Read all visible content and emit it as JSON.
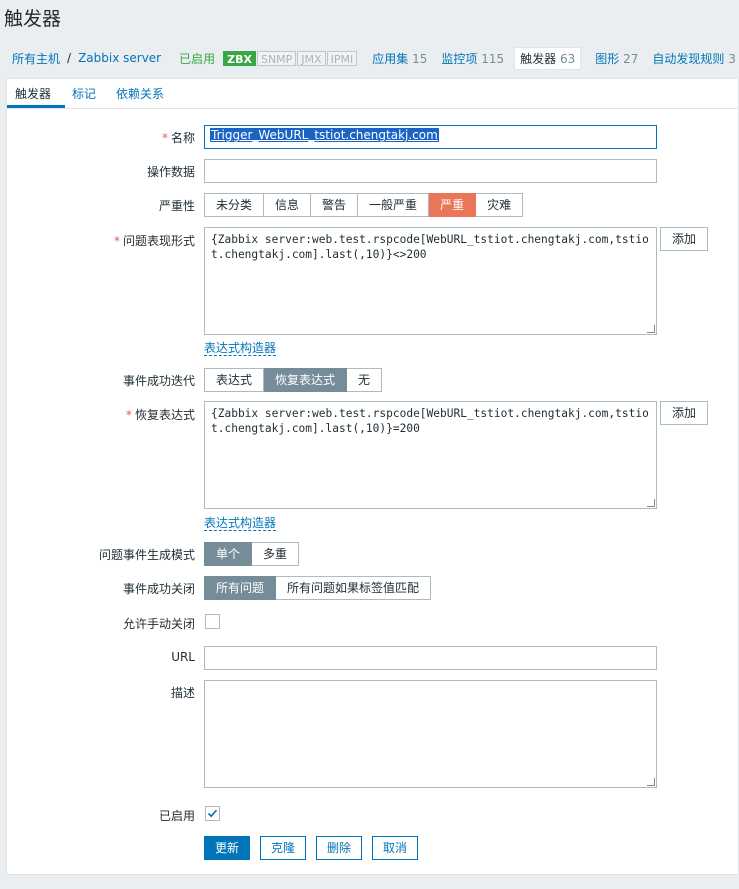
{
  "page": {
    "title": "触发器"
  },
  "nav": {
    "all_hosts": "所有主机",
    "separator": "/",
    "host": "Zabbix server",
    "status": "已启用",
    "availability": [
      "ZBX",
      "SNMP",
      "JMX",
      "IPMI"
    ],
    "links": [
      {
        "label": "应用集",
        "count": "15"
      },
      {
        "label": "监控项",
        "count": "115"
      },
      {
        "label": "触发器",
        "count": "63"
      },
      {
        "label": "图形",
        "count": "27"
      },
      {
        "label": "自动发现规则",
        "count": "3"
      }
    ]
  },
  "tabs": [
    "触发器",
    "标记",
    "依赖关系"
  ],
  "form": {
    "name_label": "名称",
    "name_value": "Trigger_WebURL_tstiot.chengtakj.com",
    "opdata_label": "操作数据",
    "opdata_value": "",
    "severity_label": "严重性",
    "severity_options": [
      "未分类",
      "信息",
      "警告",
      "一般严重",
      "严重",
      "灾难"
    ],
    "severity_selected": "严重",
    "problem_expr_label": "问题表现形式",
    "problem_expr_value": "{Zabbix server:web.test.rspcode[WebURL_tstiot.chengtakj.com,tstiot.chengtakj.com].last(,10)}<>200",
    "add_label": "添加",
    "expr_builder": "表达式构造器",
    "ok_event_label": "事件成功迭代",
    "ok_event_options": [
      "表达式",
      "恢复表达式",
      "无"
    ],
    "ok_event_selected": "恢复表达式",
    "recovery_expr_label": "恢复表达式",
    "recovery_expr_value": "{Zabbix server:web.test.rspcode[WebURL_tstiot.chengtakj.com,tstiot.chengtakj.com].last(,10)}=200",
    "event_mode_label": "问题事件生成模式",
    "event_mode_options": [
      "单个",
      "多重"
    ],
    "event_mode_selected": "单个",
    "ok_close_label": "事件成功关闭",
    "ok_close_options": [
      "所有问题",
      "所有问题如果标签值匹配"
    ],
    "ok_close_selected": "所有问题",
    "manual_close_label": "允许手动关闭",
    "manual_close_checked": false,
    "url_label": "URL",
    "url_value": "",
    "desc_label": "描述",
    "desc_value": "",
    "enabled_label": "已启用",
    "enabled_checked": true
  },
  "buttons": {
    "update": "更新",
    "clone": "克隆",
    "delete": "删除",
    "cancel": "取消"
  },
  "colors": {
    "link": "#0275b8",
    "severity_high": "#e97659",
    "segment_selected": "#768d99",
    "enabled_green": "#3aa745"
  }
}
